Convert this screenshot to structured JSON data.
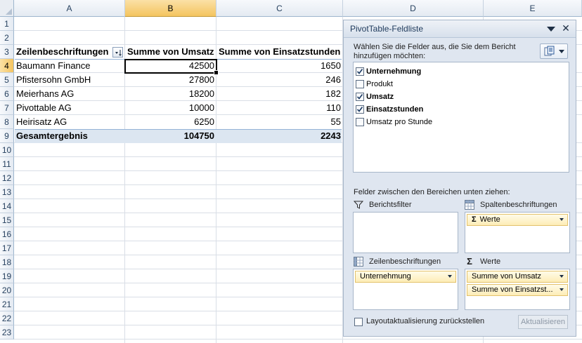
{
  "columns": [
    "A",
    "B",
    "C",
    "D",
    "E"
  ],
  "rows": [
    "1",
    "2",
    "3",
    "4",
    "5",
    "6",
    "7",
    "8",
    "9",
    "10",
    "11",
    "12",
    "13",
    "14",
    "15",
    "16",
    "17",
    "18",
    "19",
    "20",
    "21",
    "22",
    "23"
  ],
  "pivot": {
    "row_header": "Zeilenbeschriftungen",
    "col1_header": "Summe von Umsatz",
    "col2_header": "Summe von Einsatzstunden",
    "records": [
      {
        "name": "Baumann Finance",
        "umsatz": "42500",
        "stunden": "1650"
      },
      {
        "name": "Pfistersohn GmbH",
        "umsatz": "27800",
        "stunden": "246"
      },
      {
        "name": "Meierhans AG",
        "umsatz": "18200",
        "stunden": "182"
      },
      {
        "name": "Pivottable AG",
        "umsatz": "10000",
        "stunden": "110"
      },
      {
        "name": "Heirisatz AG",
        "umsatz": "6250",
        "stunden": "55"
      }
    ],
    "total_label": "Gesamtergebnis",
    "total_umsatz": "104750",
    "total_stunden": "2243"
  },
  "field_list": {
    "title": "PivotTable-Feldliste",
    "instruction": "Wählen Sie die Felder aus, die Sie dem Bericht hinzufügen möchten:",
    "fields": [
      {
        "label": "Unternehmung",
        "checked": true
      },
      {
        "label": "Produkt",
        "checked": false
      },
      {
        "label": "Umsatz",
        "checked": true
      },
      {
        "label": "Einsatzstunden",
        "checked": true
      },
      {
        "label": "Umsatz pro Stunde",
        "checked": false
      }
    ],
    "drag_label": "Felder zwischen den Bereichen unten ziehen:",
    "areas": {
      "report_filter": "Berichtsfilter",
      "column_labels": "Spaltenbeschriftungen",
      "row_labels": "Zeilenbeschriftungen",
      "values": "Werte"
    },
    "column_chip": "Werte",
    "row_chip": "Unternehmung",
    "value_chips": [
      "Summe von Umsatz",
      "Summe von Einsatzst..."
    ],
    "defer_label": "Layoutaktualisierung zurückstellen",
    "update_button": "Aktualisieren"
  }
}
